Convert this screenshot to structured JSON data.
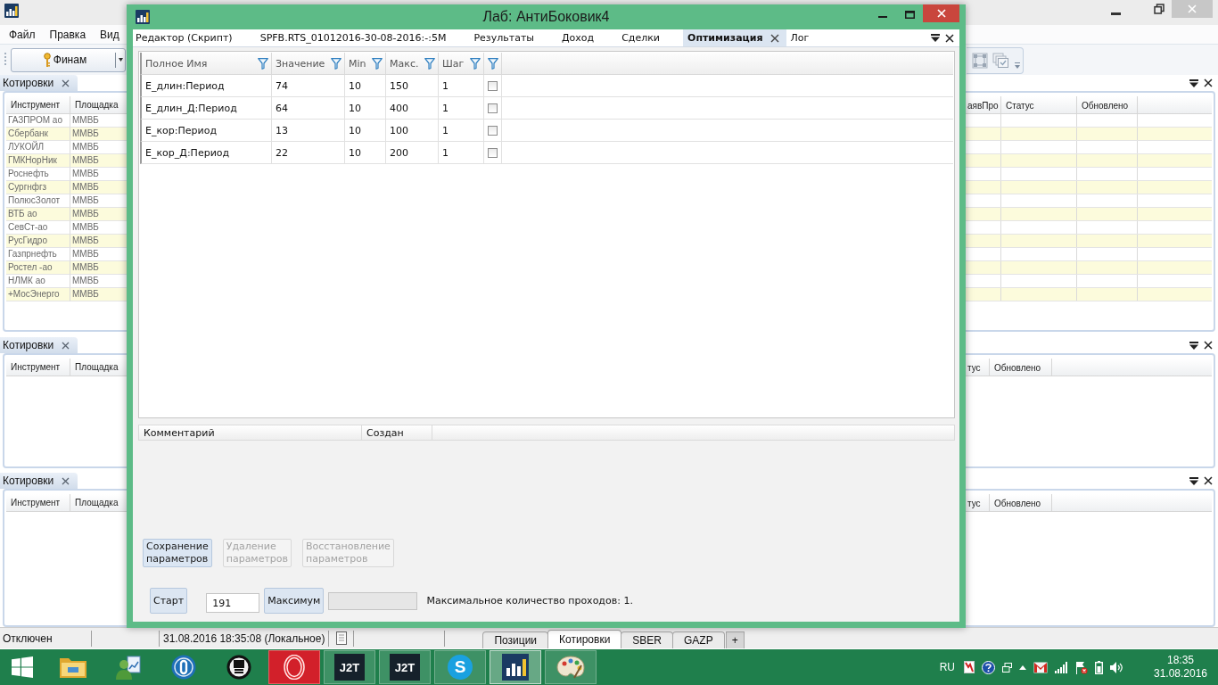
{
  "app": {
    "menu": [
      "Файл",
      "Правка",
      "Вид"
    ],
    "toolbar": {
      "broker_button": "Финам"
    },
    "quote_panes": [
      {
        "tab": "Котировки",
        "left_columns": [
          "Инструмент",
          "Площадка"
        ],
        "right_columns": [
          "аявПро",
          "Статус",
          "Обновлено"
        ],
        "rows": [
          {
            "instrument": "ГАЗПРОМ ао",
            "venue": "ММВБ"
          },
          {
            "instrument": "Сбербанк",
            "venue": "ММВБ"
          },
          {
            "instrument": "ЛУКОЙЛ",
            "venue": "ММВБ"
          },
          {
            "instrument": "ГМКНорНик",
            "venue": "ММВБ"
          },
          {
            "instrument": "Роснефть",
            "venue": "ММВБ"
          },
          {
            "instrument": "Сургнфгз",
            "venue": "ММВБ"
          },
          {
            "instrument": "ПолюсЗолот",
            "venue": "ММВБ"
          },
          {
            "instrument": "ВТБ ао",
            "venue": "ММВБ"
          },
          {
            "instrument": "СевСт-ао",
            "venue": "ММВБ"
          },
          {
            "instrument": "РусГидро",
            "venue": "ММВБ"
          },
          {
            "instrument": "Газпрнефть",
            "venue": "ММВБ"
          },
          {
            "instrument": "Ростел -ао",
            "venue": "ММВБ"
          },
          {
            "instrument": "НЛМК ао",
            "venue": "ММВБ"
          },
          {
            "instrument": "+МосЭнерго",
            "venue": "ММВБ"
          }
        ]
      },
      {
        "tab": "Котировки",
        "left_columns": [
          "Инструмент",
          "Площадка"
        ],
        "right_columns": [
          "тус",
          "Обновлено"
        ]
      },
      {
        "tab": "Котировки",
        "left_columns": [
          "Инструмент",
          "Площадка"
        ],
        "right_columns": [
          "тус",
          "Обновлено"
        ]
      }
    ],
    "status_bar": {
      "connection": "Отключен",
      "clock": "31.08.2016 18:35:08 (Локальное)",
      "tabs": [
        {
          "label": "Позиции",
          "selected": false
        },
        {
          "label": "Котировки",
          "selected": true
        },
        {
          "label": "SBER",
          "selected": false
        },
        {
          "label": "GAZP",
          "selected": false
        }
      ],
      "add_tab": "+"
    }
  },
  "dialog": {
    "title": "Лаб: АнтиБоковик4",
    "tabs": [
      {
        "label": "Редактор (Скрипт)",
        "selected": false
      },
      {
        "label": "SPFB.RTS_01012016-30-08-2016:-:5M",
        "selected": false
      },
      {
        "label": "Результаты",
        "selected": false
      },
      {
        "label": "Доход",
        "selected": false
      },
      {
        "label": "Сделки",
        "selected": false
      },
      {
        "label": "Оптимизация",
        "selected": true
      },
      {
        "label": "Лог",
        "selected": false
      }
    ],
    "parameters": {
      "columns": [
        "Полное Имя",
        "Значение",
        "Min",
        "Макс.",
        "Шаг"
      ],
      "rows": [
        {
          "name": "Е_длин:Период",
          "value": "74",
          "min": "10",
          "max": "150",
          "step": "1",
          "checked": false
        },
        {
          "name": "Е_длин_Д:Период",
          "value": "64",
          "min": "10",
          "max": "400",
          "step": "1",
          "checked": false
        },
        {
          "name": "Е_кор:Период",
          "value": "13",
          "min": "10",
          "max": "100",
          "step": "1",
          "checked": false
        },
        {
          "name": "Е_кор_Д:Период",
          "value": "22",
          "min": "10",
          "max": "200",
          "step": "1",
          "checked": false
        }
      ]
    },
    "comments": {
      "columns": [
        "Комментарий",
        "Создан"
      ]
    },
    "buttons": [
      {
        "label": "Сохранение параметров",
        "disabled": false
      },
      {
        "label": "Удаление параметров",
        "disabled": true
      },
      {
        "label": "Восстановление параметров",
        "disabled": true
      }
    ],
    "start_button": "Старт",
    "passes_field": {
      "value": "191"
    },
    "max_button": "Максимум",
    "progress": {
      "level": 0
    },
    "passes_note": "Максимальное количество проходов: 1."
  },
  "taskbar": {
    "apps": [
      {
        "kind": "folder",
        "running": false,
        "selected": false
      },
      {
        "kind": "contacts",
        "running": false,
        "selected": false
      },
      {
        "kind": "ring",
        "running": false,
        "selected": false
      },
      {
        "kind": "emblem",
        "running": false,
        "selected": false
      },
      {
        "kind": "opera",
        "running": true,
        "selected": false
      },
      {
        "kind": "text",
        "label": "J2T",
        "running": true,
        "selected": false
      },
      {
        "kind": "text",
        "label": "J2T",
        "running": true,
        "selected": false
      },
      {
        "kind": "skype",
        "label": "S",
        "running": true,
        "selected": false
      },
      {
        "kind": "chart",
        "running": true,
        "selected": true
      },
      {
        "kind": "palette",
        "running": true,
        "selected": false
      }
    ],
    "language": "RU",
    "time": "18:35",
    "date": "31.08.2016"
  }
}
